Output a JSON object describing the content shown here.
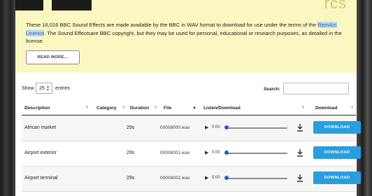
{
  "banner": {
    "text_before_link": "These 16,016 BBC Sound Effects are made available by the BBC in WAV format to download for use under the terms of the ",
    "link_text": "RemArc Licence",
    "text_after_link": ". The Sound Effectsare BBC copyright, but they may be used for personal, educational or research purposes, as detailed in the license.",
    "read_more": "READ MORE..."
  },
  "controls": {
    "show_label": "Show",
    "page_size": "25",
    "entries_label": "entries",
    "search_label": "Search:",
    "search_value": ""
  },
  "table": {
    "columns": [
      "Description",
      "Category",
      "Duration",
      "File",
      "Listen/Download",
      "Download"
    ],
    "rows": [
      {
        "description": "African market",
        "category": "",
        "duration": "29s",
        "file": "00008000.wav",
        "time": "0:00",
        "download": "DOWNLOAD"
      },
      {
        "description": "Airport exterior",
        "category": "",
        "duration": "29s",
        "file": "00008001.wav",
        "time": "0:00",
        "download": "DOWNLOAD"
      },
      {
        "description": "Airport terminal",
        "category": "",
        "duration": "29s",
        "file": "00008002.wav",
        "time": "0:00",
        "download": "DOWNLOAD"
      }
    ]
  },
  "colors": {
    "banner_bg": "#fbf7c1",
    "download_button": "#2a9dde",
    "slider_knob": "#1c5fd1",
    "link_highlight": "#b8d8f0"
  },
  "icons": [
    "play-icon",
    "volume-icon",
    "download-arrow-icon",
    "sort-arrows-icon",
    "select-arrow-icon"
  ]
}
